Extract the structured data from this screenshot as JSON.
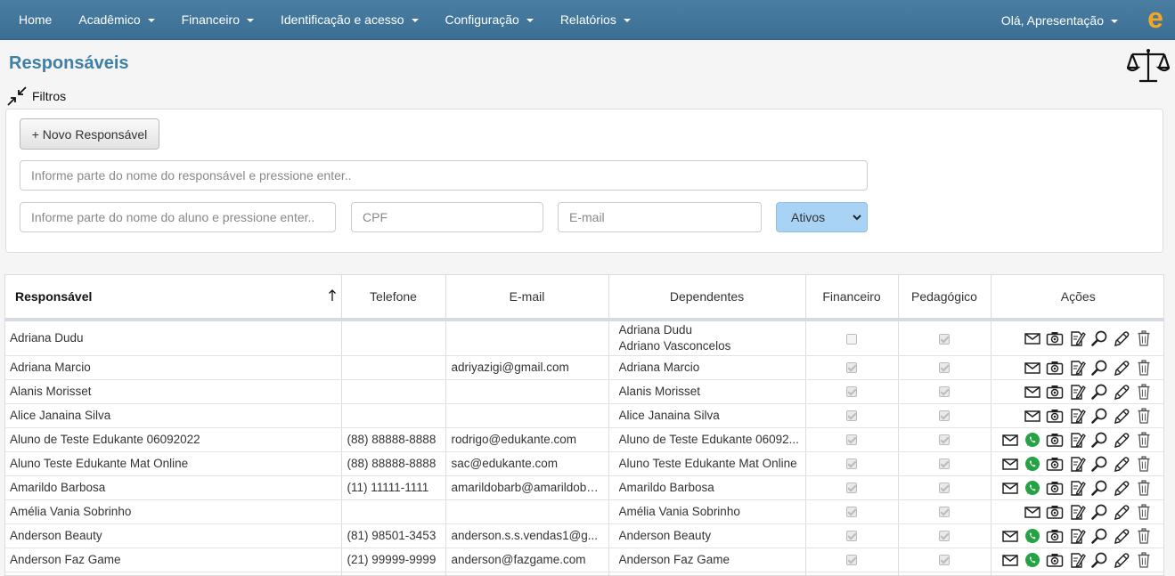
{
  "nav": {
    "items": [
      {
        "label": "Home",
        "dropdown": false
      },
      {
        "label": "Acadêmico",
        "dropdown": true
      },
      {
        "label": "Financeiro",
        "dropdown": true
      },
      {
        "label": "Identificação e acesso",
        "dropdown": true
      },
      {
        "label": "Configuração",
        "dropdown": true
      },
      {
        "label": "Relatórios",
        "dropdown": true
      }
    ],
    "user_greeting": "Olá, Apresentação",
    "logo_icon": "edukante-logo-icon",
    "logo_color": "#f5a623"
  },
  "page": {
    "title": "Responsáveis",
    "filters_label": "Filtros"
  },
  "filters": {
    "new_button": "+ Novo Responsável",
    "name_placeholder": "Informe parte do nome do responsável e pressione enter..",
    "student_placeholder": "Informe parte do nome do aluno e pressione enter..",
    "cpf_placeholder": "CPF",
    "email_placeholder": "E-mail",
    "status_selected": "Ativos"
  },
  "table": {
    "headers": [
      "Responsável",
      "Telefone",
      "E-mail",
      "Dependentes",
      "Financeiro",
      "Pedagógico",
      "Ações"
    ],
    "rows": [
      {
        "name": "Adriana Dudu",
        "phone": "",
        "email": "",
        "dependents": [
          "Adriana Dudu",
          "Adriano Vasconcelos"
        ],
        "financeiro": false,
        "pedagogico": true,
        "whatsapp": false
      },
      {
        "name": "Adriana Marcio",
        "phone": "",
        "email": "adriyazigi@gmail.com",
        "dependents": [
          "Adriana Marcio"
        ],
        "financeiro": true,
        "pedagogico": true,
        "whatsapp": false
      },
      {
        "name": "Alanis Morisset",
        "phone": "",
        "email": "",
        "dependents": [
          "Alanis Morisset"
        ],
        "financeiro": true,
        "pedagogico": true,
        "whatsapp": false
      },
      {
        "name": "Alice Janaina Silva",
        "phone": "",
        "email": "",
        "dependents": [
          "Alice Janaina Silva"
        ],
        "financeiro": true,
        "pedagogico": true,
        "whatsapp": false
      },
      {
        "name": "Aluno de Teste Edukante 06092022",
        "phone": "(88) 88888-8888",
        "email": "rodrigo@edukante.com",
        "dependents": [
          "Aluno de Teste Edukante 06092..."
        ],
        "financeiro": true,
        "pedagogico": true,
        "whatsapp": true
      },
      {
        "name": "Aluno Teste Edukante Mat Online",
        "phone": "(88) 88888-8888",
        "email": "sac@edukante.com",
        "dependents": [
          "Aluno Teste Edukante Mat Online"
        ],
        "financeiro": true,
        "pedagogico": true,
        "whatsapp": true
      },
      {
        "name": "Amarildo Barbosa",
        "phone": "(11) 11111-1111",
        "email": "amarildobarb@amarildobar...",
        "dependents": [
          "Amarildo Barbosa"
        ],
        "financeiro": true,
        "pedagogico": true,
        "whatsapp": true
      },
      {
        "name": "Amélia Vania Sobrinho",
        "phone": "",
        "email": "",
        "dependents": [
          "Amélia Vania Sobrinho"
        ],
        "financeiro": true,
        "pedagogico": true,
        "whatsapp": false
      },
      {
        "name": "Anderson Beauty",
        "phone": "(81) 98501-3453",
        "email": "anderson.s.s.vendas1@g...",
        "dependents": [
          "Anderson Beauty"
        ],
        "financeiro": true,
        "pedagogico": true,
        "whatsapp": true
      },
      {
        "name": "Anderson Faz Game",
        "phone": "(21) 99999-9999",
        "email": "anderson@fazgame.com",
        "dependents": [
          "Anderson Faz Game"
        ],
        "financeiro": true,
        "pedagogico": true,
        "whatsapp": true
      },
      {
        "name": "",
        "phone": "",
        "email": "",
        "dependents": [
          ""
        ],
        "financeiro": true,
        "pedagogico": true,
        "whatsapp": false
      }
    ],
    "action_icons": [
      "envelope-icon",
      "whatsapp-icon",
      "camera-icon",
      "edit-document-icon",
      "search-icon",
      "pencil-icon",
      "trash-icon"
    ],
    "whatsapp_color": "#25a244"
  }
}
